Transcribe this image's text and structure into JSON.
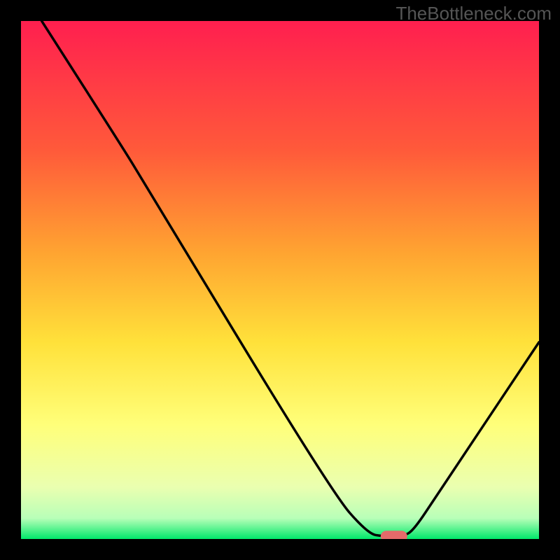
{
  "watermark": "TheBottleneck.com",
  "chart_data": {
    "type": "line",
    "title": "",
    "xlabel": "",
    "ylabel": "",
    "xlim": [
      0,
      100
    ],
    "ylim": [
      0,
      100
    ],
    "background_gradient": {
      "stops": [
        {
          "y": 0,
          "color": "#ff1f4f"
        },
        {
          "y": 25,
          "color": "#ff5a3a"
        },
        {
          "y": 45,
          "color": "#ffa531"
        },
        {
          "y": 62,
          "color": "#ffe13a"
        },
        {
          "y": 78,
          "color": "#ffff7a"
        },
        {
          "y": 90,
          "color": "#eaffb0"
        },
        {
          "y": 96,
          "color": "#b8ffb8"
        },
        {
          "y": 100,
          "color": "#00e86a"
        }
      ]
    },
    "curve": {
      "description": "V-shaped bottleneck curve with minimum near x≈70",
      "points_xy": [
        [
          4,
          100
        ],
        [
          20,
          75
        ],
        [
          23,
          70
        ],
        [
          60,
          9
        ],
        [
          67,
          1
        ],
        [
          70,
          0.5
        ],
        [
          74,
          0.5
        ],
        [
          76,
          2
        ],
        [
          80,
          8
        ],
        [
          100,
          38
        ]
      ]
    },
    "marker": {
      "description": "Recommended/optimal point marker (pink pill) at curve minimum",
      "x": 72,
      "y": 0.5,
      "color": "#e46a6a"
    }
  }
}
